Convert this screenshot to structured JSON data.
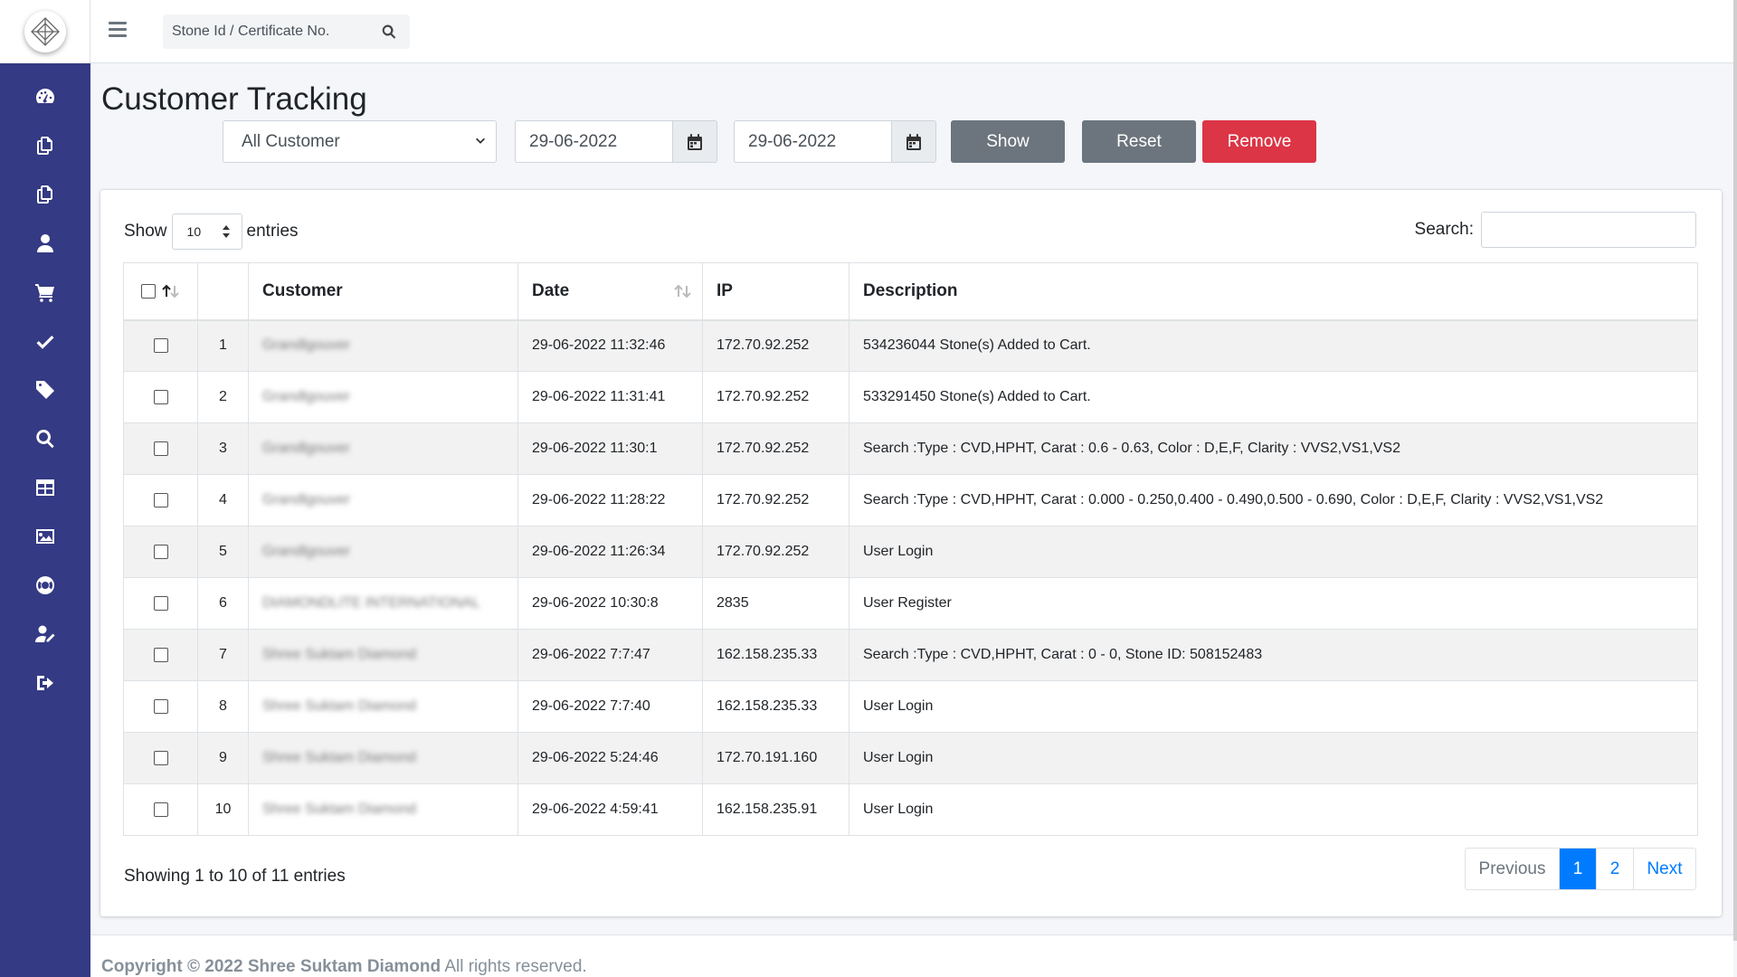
{
  "topbar": {
    "search_placeholder": "Stone Id / Certificate No."
  },
  "sidebar": {
    "items": [
      {
        "name": "dashboard-icon"
      },
      {
        "name": "copy-icon"
      },
      {
        "name": "copy-icon"
      },
      {
        "name": "user-icon"
      },
      {
        "name": "cart-icon"
      },
      {
        "name": "check-icon"
      },
      {
        "name": "tag-icon"
      },
      {
        "name": "search-icon"
      },
      {
        "name": "table-icon"
      },
      {
        "name": "image-icon"
      },
      {
        "name": "life-ring-icon"
      },
      {
        "name": "user-edit-icon"
      },
      {
        "name": "sign-out-icon"
      }
    ]
  },
  "page": {
    "title": "Customer Tracking"
  },
  "filters": {
    "customer_select": "All Customer",
    "from_date": "29-06-2022",
    "to_date": "29-06-2022",
    "show_label": "Show",
    "reset_label": "Reset",
    "remove_label": "Remove"
  },
  "table_controls": {
    "show_label": "Show",
    "entries_value": "10",
    "entries_label": "entries",
    "search_label": "Search:"
  },
  "table": {
    "headers": {
      "customer": "Customer",
      "date": "Date",
      "ip": "IP",
      "description": "Description"
    },
    "rows": [
      {
        "n": "1",
        "customer": "Grandlgouver",
        "date": "29-06-2022 11:32:46",
        "ip": "172.70.92.252",
        "description": "534236044 Stone(s) Added to Cart."
      },
      {
        "n": "2",
        "customer": "Grandlgouver",
        "date": "29-06-2022 11:31:41",
        "ip": "172.70.92.252",
        "description": "533291450 Stone(s) Added to Cart."
      },
      {
        "n": "3",
        "customer": "Grandlgouver",
        "date": "29-06-2022 11:30:1",
        "ip": "172.70.92.252",
        "description": "Search :Type : CVD,HPHT, Carat : 0.6 - 0.63, Color : D,E,F, Clarity : VVS2,VS1,VS2"
      },
      {
        "n": "4",
        "customer": "Grandlgouver",
        "date": "29-06-2022 11:28:22",
        "ip": "172.70.92.252",
        "description": "Search :Type : CVD,HPHT, Carat : 0.000 - 0.250,0.400 - 0.490,0.500 - 0.690, Color : D,E,F, Clarity : VVS2,VS1,VS2"
      },
      {
        "n": "5",
        "customer": "Grandlgouver",
        "date": "29-06-2022 11:26:34",
        "ip": "172.70.92.252",
        "description": "User Login"
      },
      {
        "n": "6",
        "customer": "DIAMONDLITE INTERNATIONAL",
        "date": "29-06-2022 10:30:8",
        "ip": "2835",
        "description": "User Register"
      },
      {
        "n": "7",
        "customer": "Shree Suktam Diamond",
        "date": "29-06-2022 7:7:47",
        "ip": "162.158.235.33",
        "description": "Search :Type : CVD,HPHT, Carat : 0 - 0, Stone ID: 508152483"
      },
      {
        "n": "8",
        "customer": "Shree Suktam Diamond",
        "date": "29-06-2022 7:7:40",
        "ip": "162.158.235.33",
        "description": "User Login"
      },
      {
        "n": "9",
        "customer": "Shree Suktam Diamond",
        "date": "29-06-2022 5:24:46",
        "ip": "172.70.191.160",
        "description": "User Login"
      },
      {
        "n": "10",
        "customer": "Shree Suktam Diamond",
        "date": "29-06-2022 4:59:41",
        "ip": "162.158.235.91",
        "description": "User Login"
      }
    ]
  },
  "pagination": {
    "info": "Showing 1 to 10 of 11 entries",
    "previous": "Previous",
    "page1": "1",
    "page2": "2",
    "next": "Next",
    "active_color": "#007bff"
  },
  "footer": {
    "copyright": "Copyright © 2022 Shree Suktam Diamond",
    "rights": " All rights reserved."
  },
  "colors": {
    "sidebar": "#343a83",
    "danger": "#dc3545",
    "secondary": "#6c757d",
    "primary": "#007bff"
  }
}
